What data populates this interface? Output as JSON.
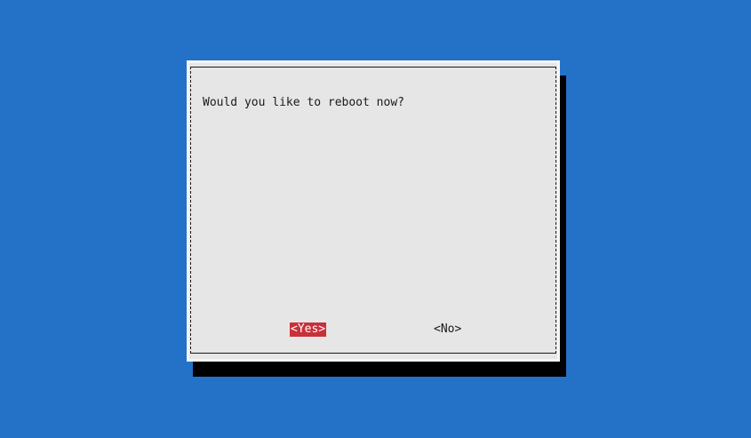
{
  "colors": {
    "background": "#2471c8",
    "dialog_bg": "#e6e6e6",
    "dialog_edge": "#f5f5f5",
    "shadow": "#000000",
    "frame_line": "#1a1a1a",
    "text": "#1a1a1a",
    "selected_bg": "#c8303a",
    "selected_text": "#ffffff"
  },
  "dialog": {
    "message": "Would you like to reboot now?",
    "yes_label": "<Yes>",
    "no_label": "<No>",
    "selected": "yes"
  }
}
